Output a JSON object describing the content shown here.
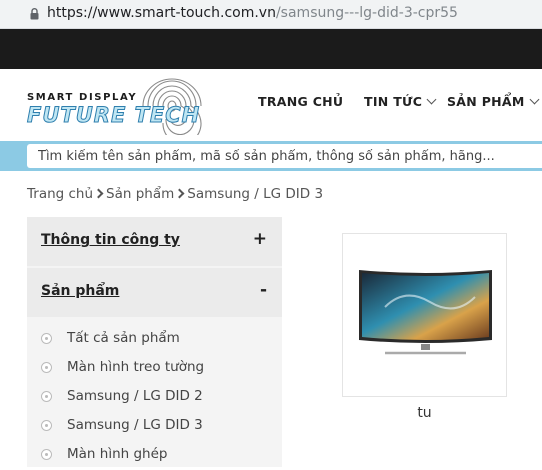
{
  "browser": {
    "url_host": "https://www.smart-touch.com.vn",
    "url_path": "/samsung---lg-did-3-cpr55"
  },
  "logo": {
    "top_text": "SMART DISPLAY",
    "bottom_text": "FUTURE TECH"
  },
  "nav": {
    "items": [
      {
        "label": "TRANG CHỦ",
        "has_dropdown": false
      },
      {
        "label": "TIN TỨC",
        "has_dropdown": true
      },
      {
        "label": "SẢN PHẨM",
        "has_dropdown": true
      }
    ]
  },
  "search": {
    "placeholder": "Tìm kiếm tên sản phẩm, mã số sản phẩm, thông số sản phẩm, hãng..."
  },
  "breadcrumb": {
    "items": [
      "Trang chủ",
      "Sản phẩm",
      "Samsung / LG DID 3"
    ]
  },
  "sidebar": {
    "sections": [
      {
        "title": "Thông tin công ty",
        "toggle": "+"
      },
      {
        "title": "Sản phẩm",
        "toggle": "-"
      }
    ],
    "categories": [
      "Tất cả sản phẩm",
      "Màn hình treo tường",
      "Samsung / LG DID 2",
      "Samsung / LG DID 3",
      "Màn hình ghép"
    ]
  },
  "products": [
    {
      "name": "tu"
    }
  ],
  "colors": {
    "search_band": "#8ccae4",
    "logo_blue": "#2f7fae",
    "dark_strip": "#1b1b1b"
  }
}
